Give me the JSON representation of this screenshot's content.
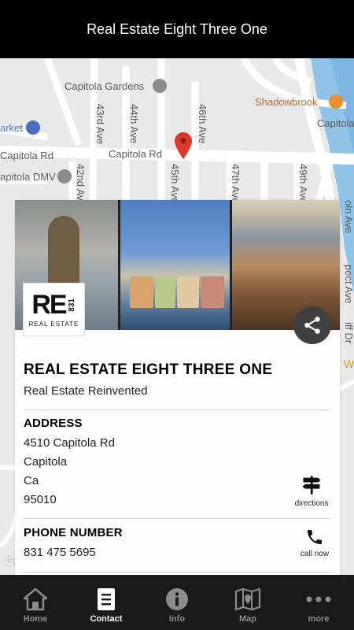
{
  "header": {
    "title": "Real Estate Eight Three One"
  },
  "map": {
    "labels": {
      "capitola_gardens": "Capitola Gardens",
      "shadowbrook": "Shadowbrook",
      "capitola_right": "Capitola",
      "market": "arket",
      "capitola_rd_left": "Capitola Rd",
      "capitola_rd": "Capitola Rd",
      "capitola_dmv": "apitola DMV",
      "ave_43": "43rd Ave",
      "ave_44": "44th Ave",
      "ave_45": "45th Ave",
      "ave_46": "46th Ave",
      "ave_47": "47th Ave",
      "ave_49": "49th Ave",
      "ave_42": "42nd Ave",
      "lincoln": "oln Ave",
      "prospect": "pect Ave",
      "cliff": "iff Dr",
      "w": "W"
    },
    "attribution": "Google"
  },
  "card": {
    "logo_main": "RE",
    "logo_numbers": "831",
    "logo_sub": "REAL ESTATE",
    "title": "REAL ESTATE EIGHT THREE ONE",
    "subtitle": "Real Estate Reinvented",
    "address": {
      "label": "ADDRESS",
      "street": "4510 Capitola Rd",
      "city": "Capitola",
      "state": "Ca",
      "zip": "95010",
      "action_label": "directions",
      "action_icon": "signpost-icon"
    },
    "phone": {
      "label": "PHONE NUMBER",
      "number": "831 475 5695",
      "action_label": "call now",
      "action_icon": "phone-icon"
    }
  },
  "tabs": [
    {
      "label": "Home",
      "icon": "home-icon",
      "active": false
    },
    {
      "label": "Contact",
      "icon": "contact-card-icon",
      "active": true
    },
    {
      "label": "Info",
      "icon": "info-icon",
      "active": false
    },
    {
      "label": "Map",
      "icon": "map-icon",
      "active": false
    },
    {
      "label": "more",
      "icon": "more-dots-icon",
      "active": false
    }
  ],
  "colors": {
    "header_bg": "#000000",
    "tabbar_bg": "#1a1a1a",
    "marker_red": "#d93a2b",
    "water_blue": "#8fc3e8"
  }
}
